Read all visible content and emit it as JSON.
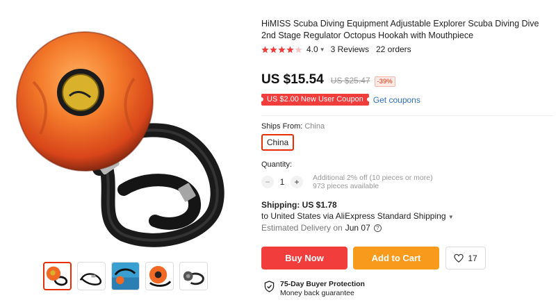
{
  "product": {
    "title": "HiMISS Scuba Diving Equipment Adjustable Explorer Scuba Diving Dive 2nd Stage Regulator Octopus Hookah with Mouthpiece",
    "rating": "4.0",
    "rating_stars": 4,
    "reviews": "3 Reviews",
    "orders": "22 orders"
  },
  "price": {
    "current": "US $15.54",
    "original": "US $25.47",
    "discount": "-39%"
  },
  "coupon": {
    "label": "US $2.00 New User Coupon",
    "link": "Get coupons"
  },
  "shipping_from": {
    "label": "Ships From:",
    "value": "China",
    "option": "China"
  },
  "quantity": {
    "label": "Quantity:",
    "minus": "−",
    "value": "1",
    "plus": "+",
    "note": "Additional 2% off (10 pieces or more)",
    "available": "973 pieces available"
  },
  "shipping": {
    "label": "Shipping: US $1.78",
    "to": "to United States via AliExpress Standard Shipping",
    "delivery_label": "Estimated Delivery on",
    "delivery_date": "Jun 07"
  },
  "actions": {
    "buy_now": "Buy Now",
    "add_to_cart": "Add to Cart",
    "wishlist_count": "17"
  },
  "protection": {
    "title": "75-Day Buyer Protection",
    "subtitle": "Money back guarantee"
  },
  "colors": {
    "accent_red": "#f23d3d",
    "cart_orange": "#f89a1c",
    "link_blue": "#2e6ec8"
  }
}
